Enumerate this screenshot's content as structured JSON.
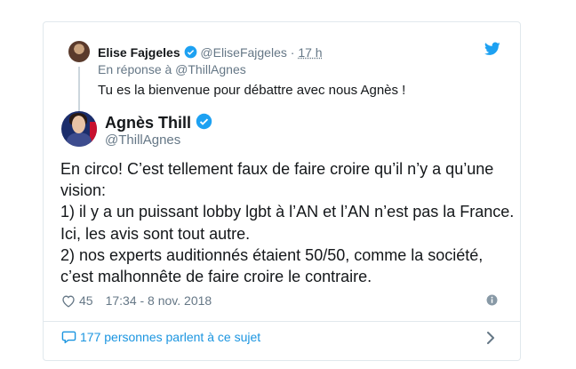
{
  "parent": {
    "name": "Elise Fajgeles",
    "handle": "@EliseFajgeles",
    "separator": " · ",
    "time": "17 h",
    "reply_to": "En réponse à @ThillAgnes",
    "text": "Tu es la bienvenue pour débattre avec nous Agnès !"
  },
  "author": {
    "name": "Agnès Thill",
    "handle": "@ThillAgnes"
  },
  "tweet": {
    "lines": [
      "En circo! C’est tellement faux de faire croire qu’il n’y a qu’une",
      "vision:",
      "1) il y a un puissant lobby lgbt à l’AN et l’AN n’est pas la France.",
      "Ici, les avis sont tout autre.",
      "2) nos experts auditionnés étaient 50/50, comme la société,",
      "c’est malhonnête de faire croire le contraire."
    ]
  },
  "meta": {
    "likes": "45",
    "datetime": "17:34 - 8 nov. 2018"
  },
  "footer": {
    "conversation": "177 personnes parlent à ce sujet"
  },
  "colors": {
    "twitter_blue": "#1da1f2",
    "link_blue": "#1b95e0",
    "muted": "#657786",
    "text": "#14171a",
    "border": "#e1e8ed"
  },
  "icons": [
    "twitter-bird-icon",
    "verified-badge-icon",
    "heart-icon",
    "info-icon",
    "reply-bubble-icon",
    "chevron-right-icon"
  ]
}
